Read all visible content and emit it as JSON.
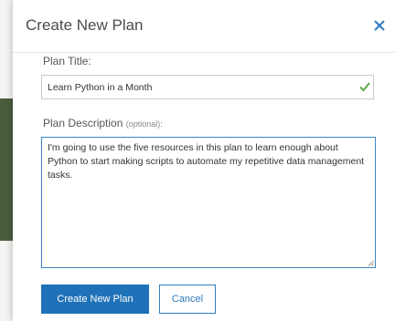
{
  "dialog": {
    "title": "Create New Plan",
    "close_icon": "close-icon"
  },
  "plan_title": {
    "label": "Plan Title:",
    "value": "Learn Python in a Month",
    "valid_icon": "checkmark-icon"
  },
  "plan_description": {
    "label": "Plan Description",
    "optional": "(optional):",
    "value": "I'm going to use the five resources in this plan to learn enough about Python to start making scripts to automate my repetitive data management tasks."
  },
  "actions": {
    "create_label": "Create New Plan",
    "cancel_label": "Cancel"
  },
  "colors": {
    "primary": "#1f72b8",
    "focus_border": "#3a85c6",
    "valid_check": "#5fa84a",
    "close_x": "#2f7cc0"
  }
}
